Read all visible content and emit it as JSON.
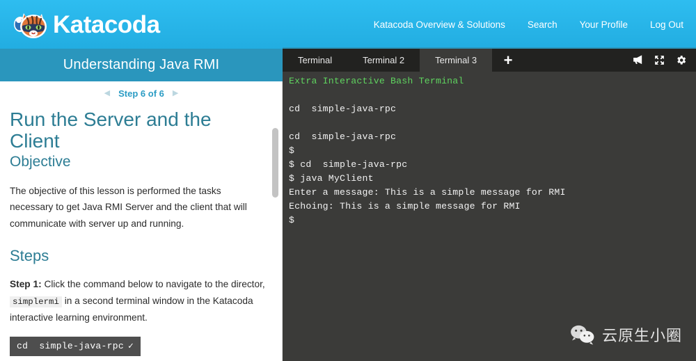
{
  "header": {
    "brand": "Katacoda",
    "brand_icon": "katacoda-cat-logo",
    "nav": [
      {
        "label": "Katacoda Overview & Solutions"
      },
      {
        "label": "Search"
      },
      {
        "label": "Your Profile"
      },
      {
        "label": "Log Out"
      }
    ],
    "background_color": "#29b6e8"
  },
  "lesson": {
    "course_title": "Understanding Java RMI",
    "course_title_bg": "#2a96bd",
    "step_nav": {
      "prev_icon": "chevron-left-icon",
      "next_icon": "chevron-right-icon",
      "label": "Step 6 of 6"
    },
    "heading": "Run the Server and the Client",
    "subheading": "Objective",
    "objective_text": "The objective of this lesson is performed the tasks necessary to get Java RMI Server and the client that will communicate with server up and running.",
    "steps_heading": "Steps",
    "step_1": {
      "label": "Step 1:",
      "text_before": " Click the command below to navigate to the director, ",
      "inline_code": "simplermi",
      "text_after": " in a second terminal window in the Katacoda interactive learning environment."
    },
    "command_box": {
      "command": "cd  simple-java-rpc",
      "tick": "✓"
    },
    "heading_color": "#2d7d94"
  },
  "terminal": {
    "tabs": [
      {
        "label": "Terminal",
        "active": false
      },
      {
        "label": "Terminal 2",
        "active": false
      },
      {
        "label": "Terminal 3",
        "active": true
      }
    ],
    "add_tab_label": "+",
    "icons": [
      {
        "name": "megaphone-icon"
      },
      {
        "name": "fullscreen-expand-icon"
      },
      {
        "name": "gear-icon"
      }
    ],
    "background_color": "#3b3b39",
    "prompt_color": "#5fd35f",
    "lines": [
      {
        "text": "Extra Interactive Bash Terminal",
        "color": "green"
      },
      {
        "text": "",
        "color": "blank"
      },
      {
        "text": "cd  simple-java-rpc",
        "color": "white"
      },
      {
        "text": "",
        "color": "blank"
      },
      {
        "text": "cd  simple-java-rpc",
        "color": "white"
      },
      {
        "text": "$",
        "color": "white"
      },
      {
        "text": "$ cd  simple-java-rpc",
        "color": "white"
      },
      {
        "text": "$ java MyClient",
        "color": "white"
      },
      {
        "text": "Enter a message: This is a simple message for RMI",
        "color": "white"
      },
      {
        "text": "Echoing: This is a simple message for RMI",
        "color": "white"
      },
      {
        "text": "$",
        "color": "white"
      }
    ]
  },
  "watermark": {
    "icon": "wechat-icon",
    "text": "云原生小圈"
  }
}
